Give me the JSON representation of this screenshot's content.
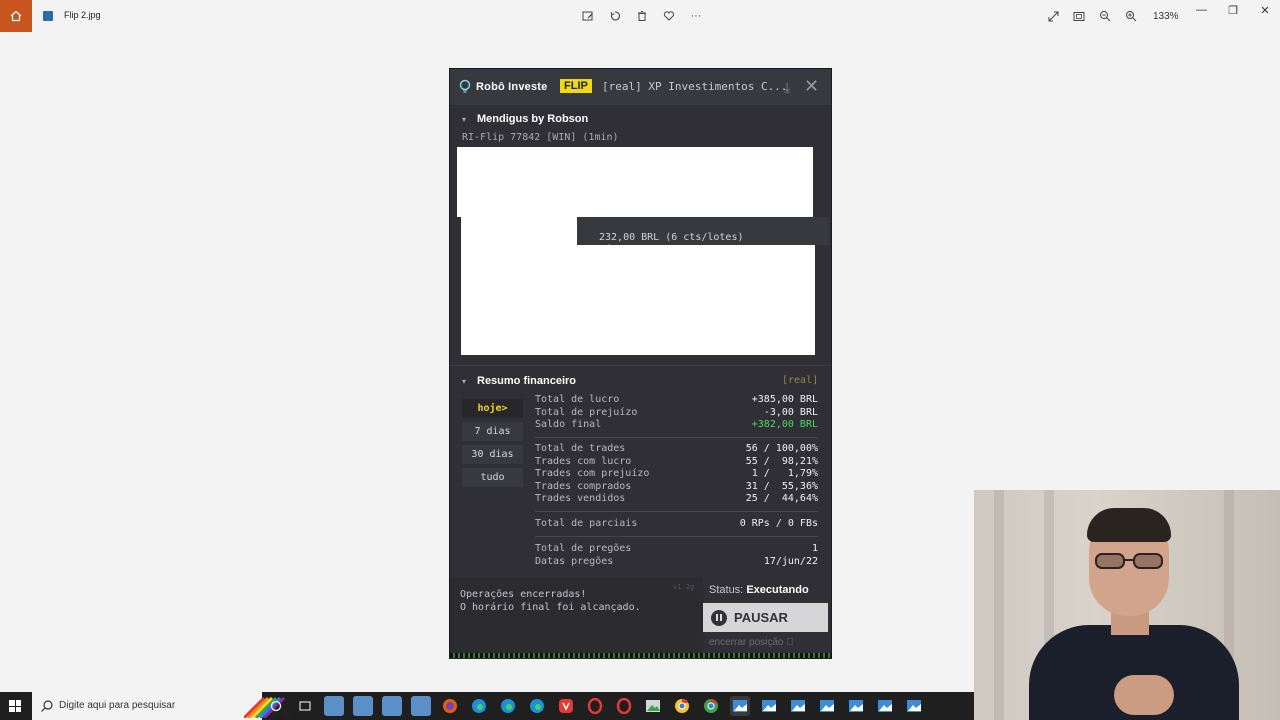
{
  "photos_app": {
    "file_name": "Flip 2.jpg",
    "zoom": "133%"
  },
  "robot": {
    "brand": "Robô Investe",
    "badge": "FLIP",
    "account": "[real] XP Investimentos C...",
    "strategy_section": {
      "title": "Mendigus by Robson",
      "strategy": "RI-Flip 77842 [WIN] (1min)",
      "tooltip": "232,00 BRL (6 cts/lotes)"
    },
    "summary": {
      "title": "Resumo financeiro",
      "mode_tag": "[real]",
      "periods": [
        "hoje>",
        "7 dias",
        "30 dias",
        "tudo"
      ],
      "active_period": "hoje>",
      "group1": [
        {
          "label": "Total de lucro",
          "value": "+385,00 BRL"
        },
        {
          "label": "Total de prejuízo",
          "value": "-3,00 BRL"
        },
        {
          "label": "Saldo final",
          "value": "+382,00 BRL"
        }
      ],
      "group2": [
        {
          "label": "Total de trades",
          "value": "56 / 100,00%"
        },
        {
          "label": "Trades com lucro",
          "value": "55 /  98,21%"
        },
        {
          "label": "Trades com prejuízo",
          "value": "1 /   1,79%"
        },
        {
          "label": "Trades comprados",
          "value": "31 /  55,36%"
        },
        {
          "label": "Trades vendidos",
          "value": "25 /  44,64%"
        }
      ],
      "group3": [
        {
          "label": "Total de parciais",
          "value": "0 RPs / 0 FBs"
        }
      ],
      "group4": [
        {
          "label": "Total de pregões",
          "value": "1"
        },
        {
          "label": "Datas pregões",
          "value": "17/jun/22"
        }
      ],
      "positive_color": "#4cd964"
    },
    "footer": {
      "message_line1": "Operações encerradas!",
      "message_line2": "O horário final foi alcançado.",
      "version": "v1.2g",
      "status_label": "Status:",
      "status_value": "Executando",
      "pause_label": "PAUSAR",
      "close_position_label": "encerrar posição"
    },
    "accent_color": "#f0d817"
  },
  "taskbar": {
    "search_placeholder": "Digite aqui para pesquisar"
  }
}
